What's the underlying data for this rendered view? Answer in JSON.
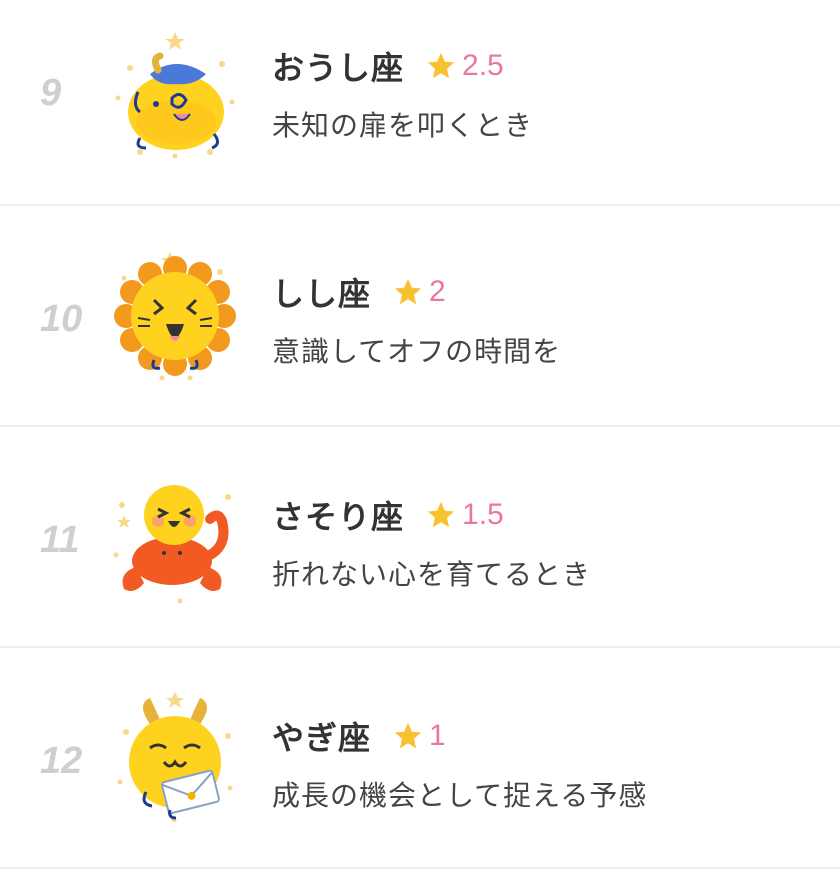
{
  "accent_color": "#e9799b",
  "star_color": "#f7c12f",
  "rankings": [
    {
      "rank": "9",
      "sign": "おうし座",
      "score": "2.5",
      "message": "未知の扉を叩くとき",
      "icon": "taurus-mascot-icon"
    },
    {
      "rank": "10",
      "sign": "しし座",
      "score": "2",
      "message": "意識してオフの時間を",
      "icon": "leo-mascot-icon"
    },
    {
      "rank": "11",
      "sign": "さそり座",
      "score": "1.5",
      "message": "折れない心を育てるとき",
      "icon": "scorpio-mascot-icon"
    },
    {
      "rank": "12",
      "sign": "やぎ座",
      "score": "1",
      "message": "成長の機会として捉える予感",
      "icon": "capricorn-mascot-icon"
    }
  ]
}
